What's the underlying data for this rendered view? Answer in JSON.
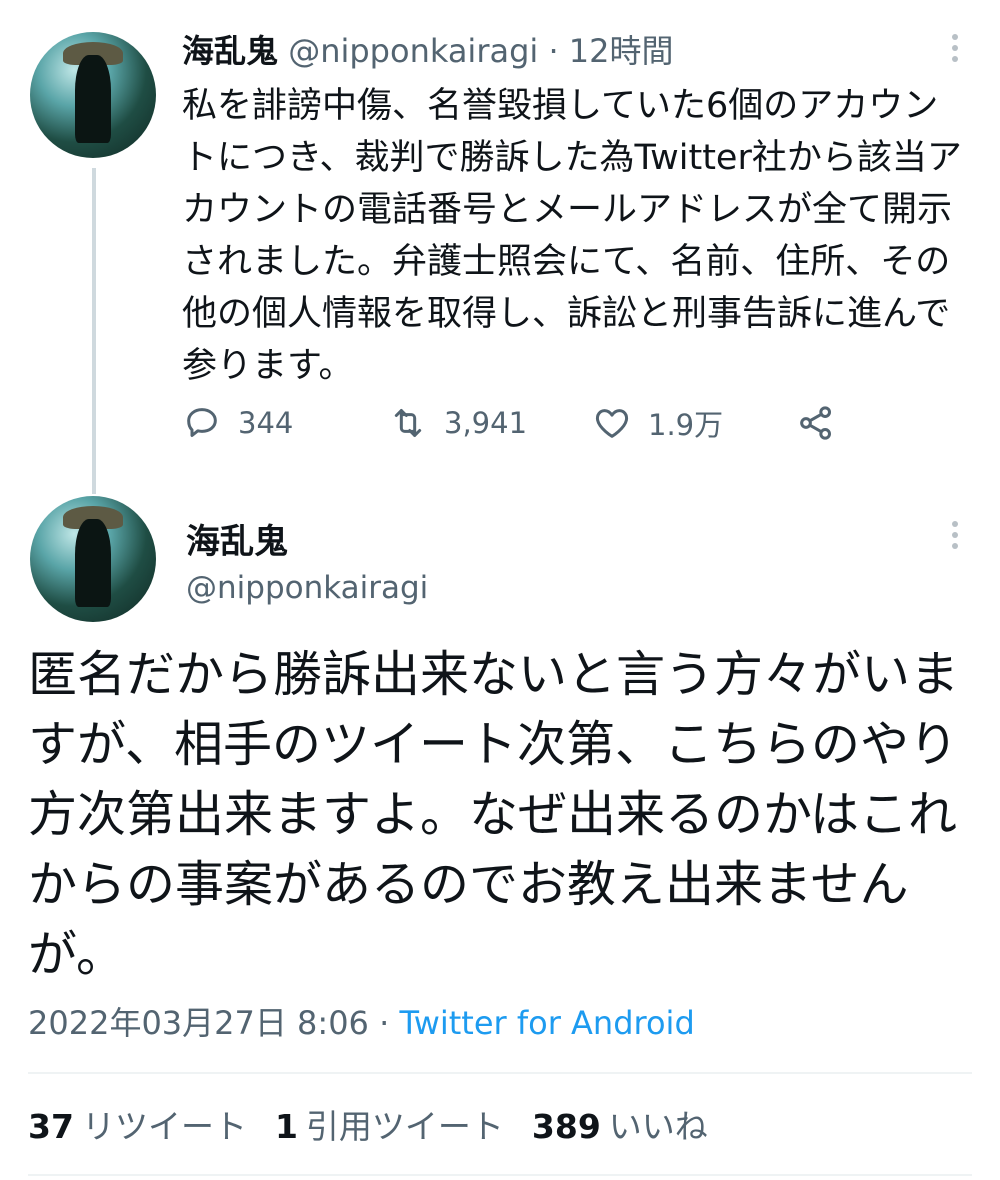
{
  "tweet1": {
    "display_name": "海乱鬼",
    "handle": "@nipponkairagi",
    "separator": "·",
    "time": "12時間",
    "body": "私を誹謗中傷、名誉毀損していた6個のアカウントにつき、裁判で勝訴した為Twitter社から該当アカウントの電話番号とメールアドレスが全て開示されました。弁護士照会にて、名前、住所、その他の個人情報を取得し、訴訟と刑事告訴に進んで参ります。",
    "actions": {
      "replies": "344",
      "retweets": "3,941",
      "likes": "1.9万"
    }
  },
  "tweet2": {
    "display_name": "海乱鬼",
    "handle": "@nipponkairagi",
    "body": "匿名だから勝訴出来ないと言う方々がいますが、相手のツイート次第、こちらのやり方次第出来ますよ。なぜ出来るのかはこれからの事案があるのでお教え出来ませんが。",
    "timestamp": "2022年03月27日 8:06",
    "separator": "·",
    "source": "Twitter for Android"
  },
  "stats": {
    "retweets_count": "37",
    "retweets_label": "リツイート",
    "quotes_count": "1",
    "quotes_label": "引用ツイート",
    "likes_count": "389",
    "likes_label": "いいね"
  },
  "icons": {
    "reply": "reply-icon",
    "retweet": "retweet-icon",
    "like": "heart-icon",
    "share": "share-icon",
    "more": "more-icon"
  },
  "colors": {
    "text": "#0f1419",
    "secondary": "#536471",
    "link": "#1d9bf0",
    "divider": "#eff3f4"
  }
}
